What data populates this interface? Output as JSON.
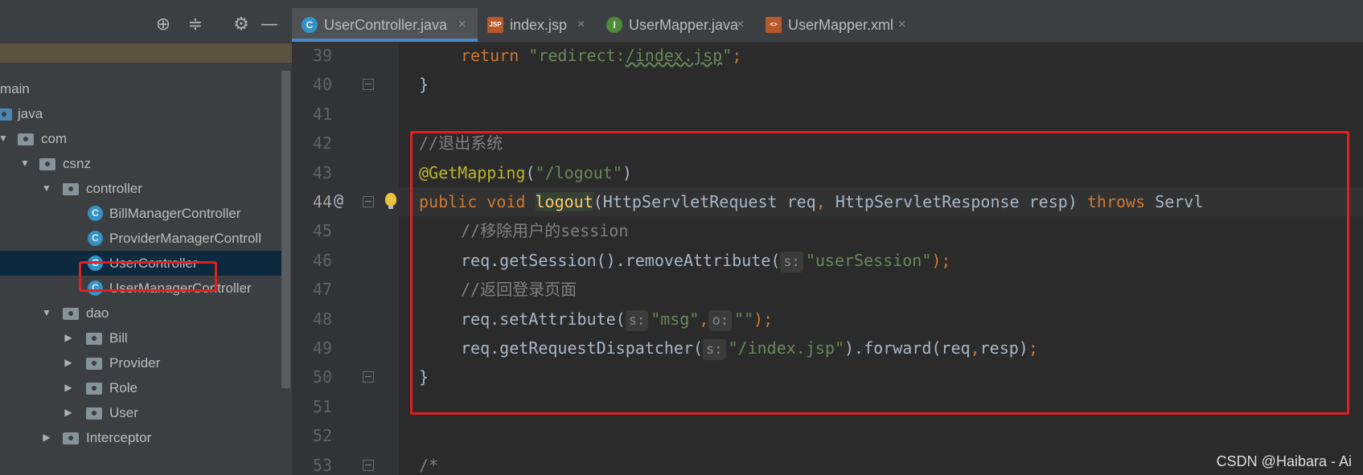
{
  "colors": {
    "keyword": "#cc7832",
    "string": "#6a8759",
    "comment": "#808080",
    "annotation": "#bbb529",
    "method": "#ffc66d",
    "highlight_box": "#e02020",
    "tab_accent": "#4a88c7"
  },
  "project_panel": {
    "toolbar_icons": [
      "crosshair-icon",
      "collapse-all-icon",
      "gear-icon",
      "minimize-icon"
    ],
    "tree": [
      {
        "label": "main",
        "type": "folder-partial"
      },
      {
        "label": "java",
        "type": "source-folder"
      },
      {
        "label": "com",
        "type": "package"
      },
      {
        "label": "csnz",
        "type": "package"
      },
      {
        "label": "controller",
        "type": "package"
      },
      {
        "label": "BillManagerController",
        "type": "class"
      },
      {
        "label": "ProviderManagerControll",
        "type": "class"
      },
      {
        "label": "UserController",
        "type": "class",
        "selected": true
      },
      {
        "label": "UserManagerController",
        "type": "class"
      },
      {
        "label": "dao",
        "type": "package"
      },
      {
        "label": "Bill",
        "type": "package"
      },
      {
        "label": "Provider",
        "type": "package"
      },
      {
        "label": "Role",
        "type": "package"
      },
      {
        "label": "User",
        "type": "package"
      },
      {
        "label": "Interceptor",
        "type": "package"
      }
    ]
  },
  "tabs": [
    {
      "label": "UserController.java",
      "icon": "class-icon",
      "icon_text": "C",
      "active": true
    },
    {
      "label": "index.jsp",
      "icon": "jsp-file-icon",
      "icon_text": "JSP",
      "active": false
    },
    {
      "label": "UserMapper.java",
      "icon": "interface-icon",
      "icon_text": "I",
      "active": false
    },
    {
      "label": "UserMapper.xml",
      "icon": "xml-file-icon",
      "icon_text": "<>",
      "active": false
    }
  ],
  "tab_close_glyph": "×",
  "editor": {
    "current_line": 44,
    "gutter_marker": "@",
    "lines": [
      {
        "n": "39",
        "indent": 2,
        "tokens": [
          {
            "t": "return ",
            "c": "kw"
          },
          {
            "t": "\"redirect:",
            "c": "str"
          },
          {
            "t": "/index.jsp",
            "c": "str uline"
          },
          {
            "t": "\"",
            "c": "str"
          },
          {
            "t": ";",
            "c": "kw"
          }
        ]
      },
      {
        "n": "40",
        "indent": 1,
        "tokens": [
          {
            "t": "}",
            "c": ""
          }
        ]
      },
      {
        "n": "41",
        "indent": 0,
        "tokens": []
      },
      {
        "n": "42",
        "indent": 1,
        "tokens": [
          {
            "t": "//退出系统",
            "c": "cmt"
          }
        ]
      },
      {
        "n": "43",
        "indent": 1,
        "tokens": [
          {
            "t": "@GetMapping",
            "c": "ann"
          },
          {
            "t": "(",
            "c": ""
          },
          {
            "t": "\"/logout\"",
            "c": "str"
          },
          {
            "t": ")",
            "c": ""
          }
        ]
      },
      {
        "n": "44",
        "indent": 1,
        "tokens": [
          {
            "t": "public ",
            "c": "kw"
          },
          {
            "t": "void ",
            "c": "kw"
          },
          {
            "t": "logout",
            "c": "mth ident-hl"
          },
          {
            "t": "(HttpServletRequest req",
            "c": ""
          },
          {
            "t": ", ",
            "c": "kw"
          },
          {
            "t": "HttpServletResponse resp) ",
            "c": ""
          },
          {
            "t": "throws ",
            "c": "kw"
          },
          {
            "t": "Servl",
            "c": ""
          }
        ]
      },
      {
        "n": "45",
        "indent": 2,
        "tokens": [
          {
            "t": "//移除用户的session",
            "c": "cmt"
          }
        ]
      },
      {
        "n": "46",
        "indent": 2,
        "tokens": [
          {
            "t": "req.getSession().removeAttribute(",
            "c": ""
          },
          {
            "t": "s:",
            "c": "hint"
          },
          {
            "t": "\"userSession\"",
            "c": "str"
          },
          {
            "t": ");",
            "c": "kw"
          }
        ]
      },
      {
        "n": "47",
        "indent": 2,
        "tokens": [
          {
            "t": "//返回登录页面",
            "c": "cmt"
          }
        ]
      },
      {
        "n": "48",
        "indent": 2,
        "tokens": [
          {
            "t": "req.setAttribute(",
            "c": ""
          },
          {
            "t": "s:",
            "c": "hint"
          },
          {
            "t": "\"msg\"",
            "c": "str"
          },
          {
            "t": ",",
            "c": "kw"
          },
          {
            "t": "o:",
            "c": "hint"
          },
          {
            "t": "\"\"",
            "c": "str"
          },
          {
            "t": ");",
            "c": "kw"
          }
        ]
      },
      {
        "n": "49",
        "indent": 2,
        "tokens": [
          {
            "t": "req.getRequestDispatcher(",
            "c": ""
          },
          {
            "t": "s:",
            "c": "hint"
          },
          {
            "t": "\"/index.jsp\"",
            "c": "str"
          },
          {
            "t": ").forward(req",
            "c": ""
          },
          {
            "t": ",",
            "c": "kw"
          },
          {
            "t": "resp)",
            "c": ""
          },
          {
            "t": ";",
            "c": "kw"
          }
        ]
      },
      {
        "n": "50",
        "indent": 1,
        "tokens": [
          {
            "t": "}",
            "c": ""
          }
        ]
      },
      {
        "n": "51",
        "indent": 0,
        "tokens": []
      },
      {
        "n": "52",
        "indent": 0,
        "tokens": []
      },
      {
        "n": "53",
        "indent": 1,
        "tokens": [
          {
            "t": "/*",
            "c": "cmt"
          }
        ]
      }
    ]
  },
  "watermark": "CSDN @Haibara - Ai"
}
